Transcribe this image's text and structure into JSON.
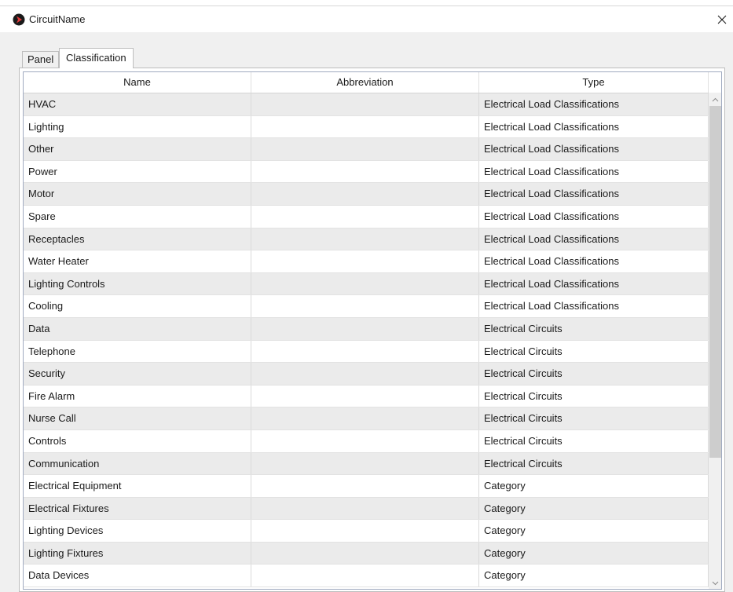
{
  "window": {
    "title": "CircuitName",
    "app_icon": "red-arrow-circle-icon",
    "close_icon": "close-icon",
    "accent_color": "#c42b1c"
  },
  "tabs": [
    {
      "label": "Panel",
      "active": false
    },
    {
      "label": "Classification",
      "active": true
    }
  ],
  "grid": {
    "columns": [
      "Name",
      "Abbreviation",
      "Type"
    ],
    "rows": [
      {
        "name": "HVAC",
        "abbreviation": "",
        "type": "Electrical Load Classifications"
      },
      {
        "name": "Lighting",
        "abbreviation": "",
        "type": "Electrical Load Classifications"
      },
      {
        "name": "Other",
        "abbreviation": "",
        "type": "Electrical Load Classifications"
      },
      {
        "name": "Power",
        "abbreviation": "",
        "type": "Electrical Load Classifications"
      },
      {
        "name": "Motor",
        "abbreviation": "",
        "type": "Electrical Load Classifications"
      },
      {
        "name": "Spare",
        "abbreviation": "",
        "type": "Electrical Load Classifications"
      },
      {
        "name": "Receptacles",
        "abbreviation": "",
        "type": "Electrical Load Classifications"
      },
      {
        "name": "Water Heater",
        "abbreviation": "",
        "type": "Electrical Load Classifications"
      },
      {
        "name": "Lighting Controls",
        "abbreviation": "",
        "type": "Electrical Load Classifications"
      },
      {
        "name": "Cooling",
        "abbreviation": "",
        "type": "Electrical Load Classifications"
      },
      {
        "name": "Data",
        "abbreviation": "",
        "type": "Electrical Circuits"
      },
      {
        "name": "Telephone",
        "abbreviation": "",
        "type": "Electrical Circuits"
      },
      {
        "name": "Security",
        "abbreviation": "",
        "type": "Electrical Circuits"
      },
      {
        "name": "Fire Alarm",
        "abbreviation": "",
        "type": "Electrical Circuits"
      },
      {
        "name": "Nurse Call",
        "abbreviation": "",
        "type": "Electrical Circuits"
      },
      {
        "name": "Controls",
        "abbreviation": "",
        "type": "Electrical Circuits"
      },
      {
        "name": "Communication",
        "abbreviation": "",
        "type": "Electrical Circuits"
      },
      {
        "name": "Electrical Equipment",
        "abbreviation": "",
        "type": "Category"
      },
      {
        "name": "Electrical Fixtures",
        "abbreviation": "",
        "type": "Category"
      },
      {
        "name": "Lighting Devices",
        "abbreviation": "",
        "type": "Category"
      },
      {
        "name": "Lighting Fixtures",
        "abbreviation": "",
        "type": "Category"
      },
      {
        "name": "Data Devices",
        "abbreviation": "",
        "type": "Category"
      }
    ]
  },
  "scrollbar": {
    "up_icon": "chevron-up-icon",
    "down_icon": "chevron-down-icon"
  }
}
